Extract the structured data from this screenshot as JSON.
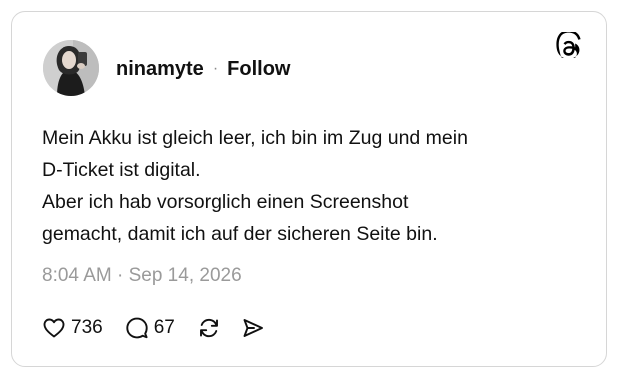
{
  "post": {
    "author": {
      "username": "ninamyte",
      "separator": "·",
      "follow_label": "Follow"
    },
    "text_lines": [
      "Mein Akku ist gleich leer, ich bin im Zug und mein",
      "D-Ticket ist digital.",
      "Aber ich hab vorsorglich einen Screenshot",
      "gemacht, damit ich auf der sicheren Seite bin."
    ],
    "timestamp": "8:04 AM · Sep 14, 2026",
    "actions": {
      "likes": "736",
      "replies": "67"
    }
  },
  "icons": {
    "brand": "threads-logo-icon",
    "like": "heart-icon",
    "reply": "comment-bubble-icon",
    "repost": "repost-icon",
    "share": "send-icon"
  },
  "colors": {
    "text": "#111111",
    "muted": "#9a9a9a",
    "border": "#d6d6d6"
  }
}
